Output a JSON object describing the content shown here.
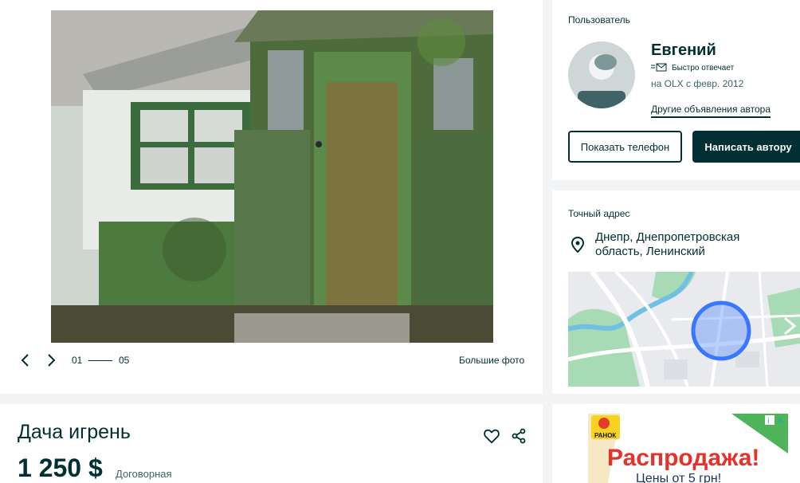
{
  "gallery": {
    "counter_current": "01",
    "counter_total": "05",
    "big_photo_label": "Большие фото"
  },
  "user": {
    "heading": "Пользователь",
    "name": "Евгений",
    "fast_answer": "Быстро отвечает",
    "since": "на OLX с февр. 2012",
    "other_ads_link": "Другие объявления автора",
    "show_phone_button": "Показать телефон",
    "write_button": "Написать автору"
  },
  "address": {
    "heading": "Точный адрес",
    "text": "Днепр, Днепропетровская область, Ленинский"
  },
  "listing": {
    "title": "Дача игрень",
    "price": "1 250 $",
    "negotiable": "Договорная"
  },
  "ad": {
    "brand": "РАНОК",
    "headline": "Распродажа!",
    "subline": "Цены от 5 грн!"
  },
  "colors": {
    "primary": "#002f34",
    "background": "#f2f4f5",
    "map_marker": "#3a77ff"
  },
  "icons": {
    "prev": "chevron-left-icon",
    "next": "chevron-right-icon",
    "favorite": "heart-icon",
    "share": "share-icon",
    "location": "location-pin-icon",
    "fast_answer": "message-icon"
  }
}
